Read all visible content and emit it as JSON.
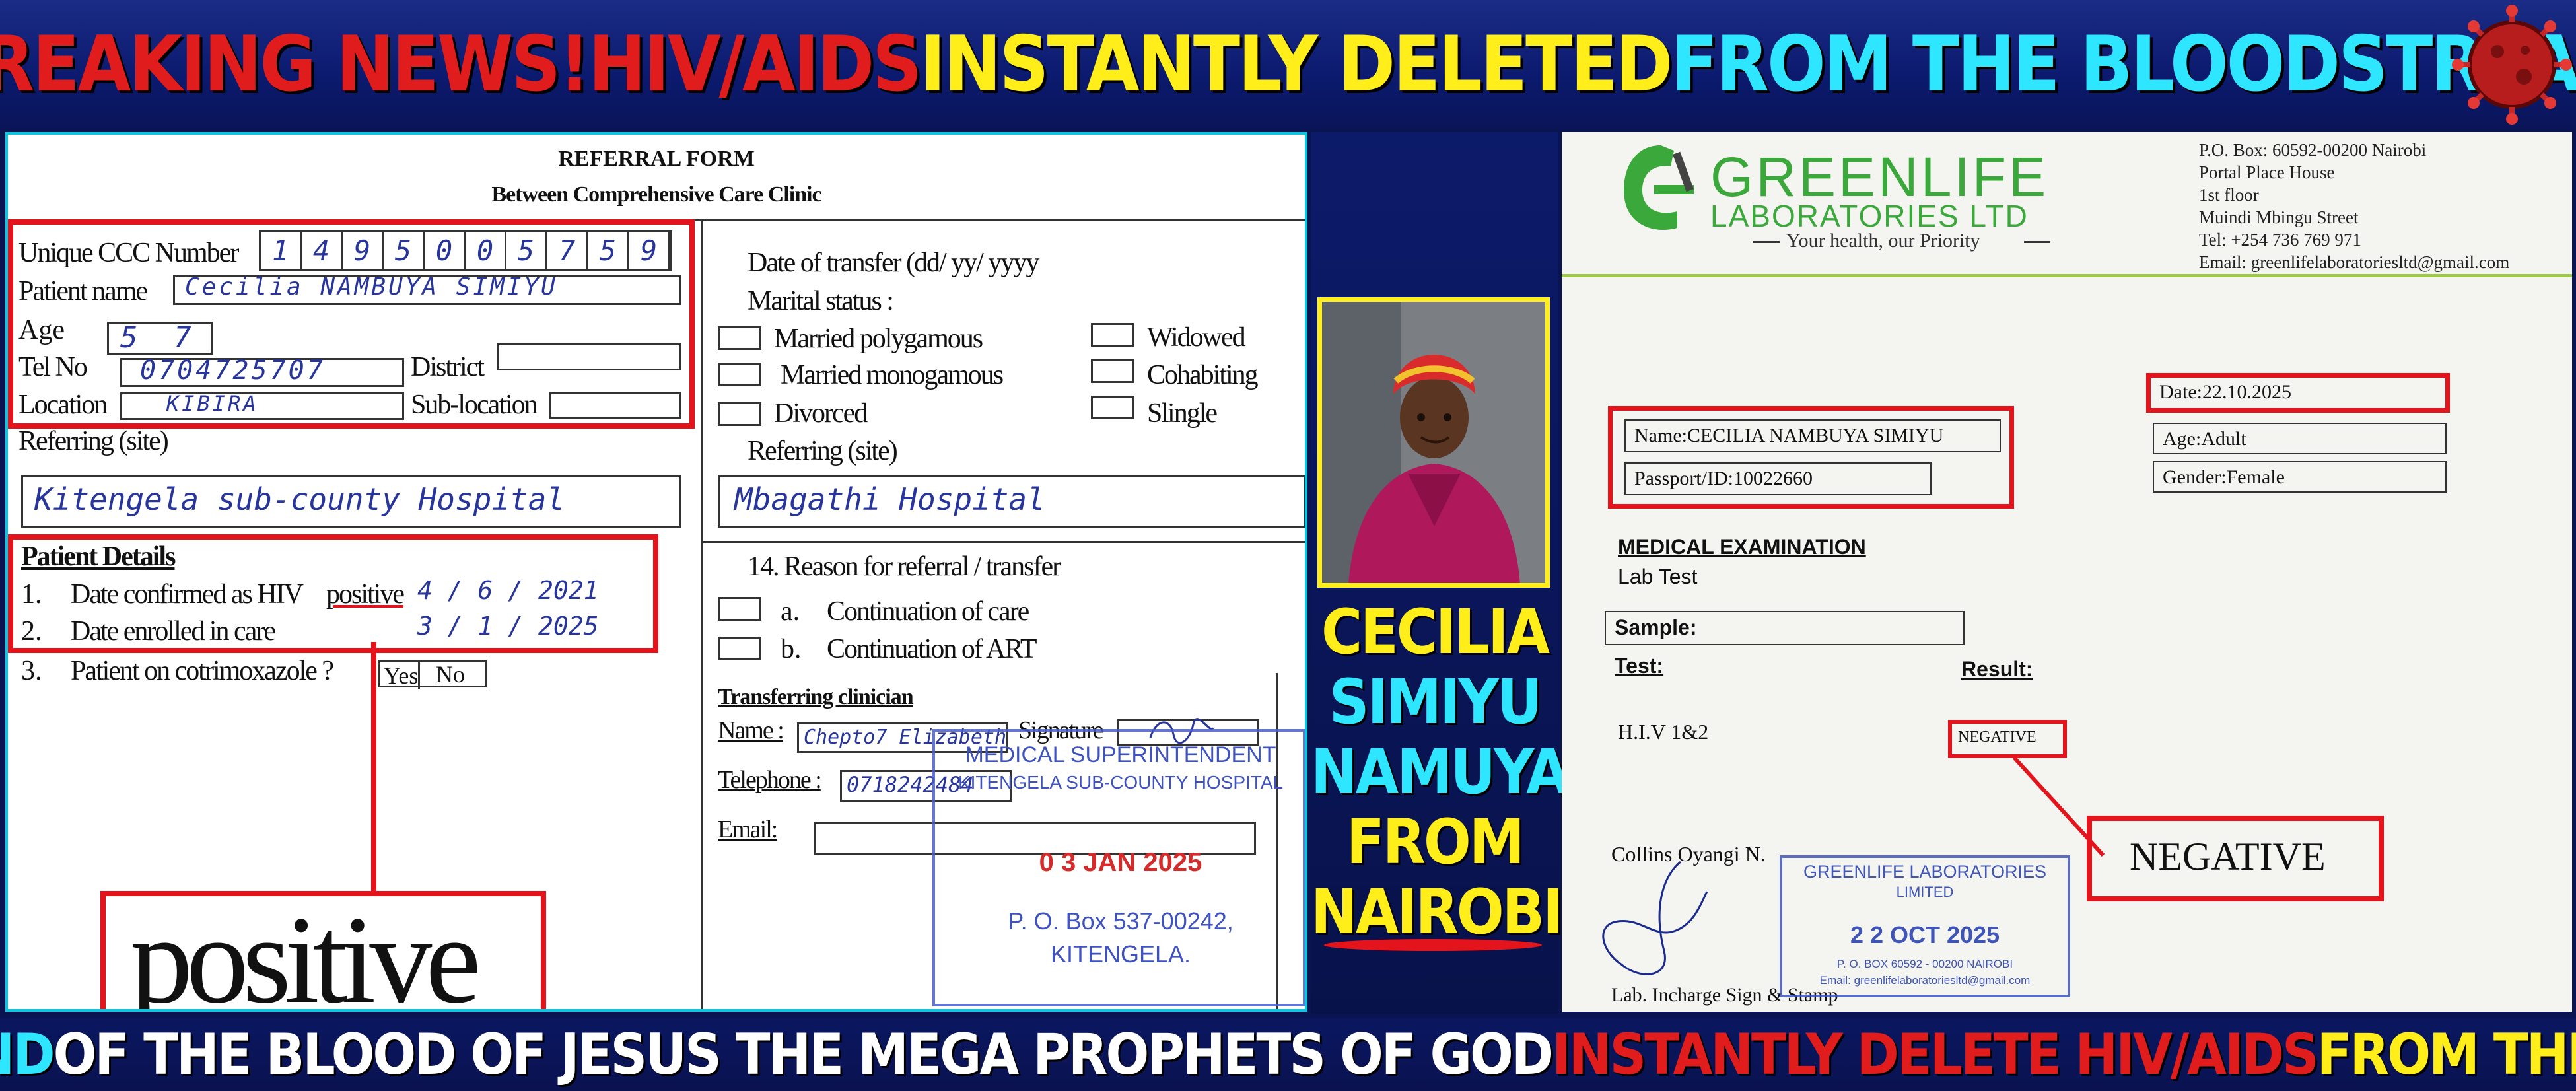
{
  "header": {
    "part1": "BREAKING NEWS!",
    "part2": "HIV/AIDS",
    "part3": "INSTANTLY DELETED",
    "part4": "FROM THE BLOODSTREAM"
  },
  "footer": {
    "part1": "AT ONE COMMAND",
    "part2": "OF THE BLOOD OF JESUS THE MEGA PROPHETS OF GOD",
    "part3": "INSTANTLY DELETE HIV/AIDS",
    "part4": "FROM THE BLOODSTREAM"
  },
  "referral": {
    "title": "REFERRAL FORM",
    "subtitle": "Between Comprehensive Care Clinic",
    "ccc_label": "Unique CCC Number",
    "ccc_digits": [
      "1",
      "4",
      "9",
      "5",
      "0",
      "0",
      "5",
      "7",
      "5",
      "9"
    ],
    "name_label": "Patient name",
    "name_value": "Cecilia NAMBUYA SIMIYU",
    "age_label": "Age",
    "age_value": "5 7",
    "tel_label": "Tel No",
    "tel_value": "0704725707",
    "district_label": "District",
    "location_label": "Location",
    "location_value": "KIBIRA",
    "sublocation_label": "Sub-location",
    "referring_label": "Referring (site)",
    "referring_value": "Kitengela sub-county Hospital",
    "date_transfer_label": "Date of transfer (dd/ yy/ yyyy",
    "marital_label": "Marital status :",
    "married_poly": "Married polygamous",
    "married_mono": "Married monogamous",
    "divorced": "Divorced",
    "widowed": "Widowed",
    "cohabiting": "Cohabiting",
    "single": "Slingle",
    "referring_to_label": "Referring (site)",
    "referring_to_value": "Mbagathi Hospital",
    "details_heading": "Patient Details",
    "d1_num": "1.",
    "d1_label": "Date confirmed as HIV",
    "d1_word": "positive",
    "d1_value": "4 / 6 / 2021",
    "d2_num": "2.",
    "d2_label": "Date enrolled in care",
    "d2_value": "3 / 1 / 2025",
    "d3_num": "3.",
    "d3_label": "Patient on cotrimoxazole ?",
    "d3_yes": "Yes",
    "d3_no": "No",
    "zoom_word": "positive",
    "reason_label": "14.   Reason for referral / transfer",
    "reason_a_letter": "a.",
    "reason_a": "Continuation of care",
    "reason_b_letter": "b.",
    "reason_b": "Continuation of ART",
    "clinician_heading": "Transferring clinician",
    "clin_name_label": "Name :",
    "clin_name_value": "Chepto7 Elizabeth",
    "signature_label": "Signature",
    "telephone_label": "Telephone :",
    "telephone_value": "0718242484",
    "email_label": "Email:",
    "stamp_line1": "MEDICAL SUPERINTENDENT",
    "stamp_line2": "KITENGELA SUB-COUNTY HOSPITAL",
    "stamp_date": "0 3 JAN 2025",
    "stamp_box": "P. O. Box 537-00242,",
    "stamp_town": "KITENGELA."
  },
  "person": {
    "name_lines": [
      "CECILIA",
      "SIMIYU",
      "NAMUYA",
      "FROM",
      "NAIROBI"
    ]
  },
  "lab": {
    "logo_line1": "GREENLIFE",
    "logo_line2": "LABORATORIES LTD",
    "tagline": "Your health, our Priority",
    "addr": [
      "P.O. Box: 60592-00200 Nairobi",
      "Portal Place House",
      "1st floor",
      "Muindi Mbingu Street",
      "Tel: +254 736 769 971",
      "Email: greenlifelaboratoriesltd@gmail.com"
    ],
    "date": "Date:22.10.2025",
    "age": "Age:Adult",
    "gender": "Gender:Female",
    "name": "Name:CECILIA  NAMBUYA  SIMIYU",
    "passport": "Passport/ID:10022660",
    "exam_heading": "MEDICAL EXAMINATION",
    "lab_test": "Lab Test",
    "sample": "Sample:",
    "test_label": "Test:",
    "result_label": "Result:",
    "test_name": "H.I.V 1&2",
    "result_small": "NEGATIVE",
    "result_big": "NEGATIVE",
    "tech": "Collins Oyangi N.",
    "incharge": "Lab. Incharge Sign & Stamp",
    "stamp_line1": "GREENLIFE LABORATORIES",
    "stamp_line2": "LIMITED",
    "stamp_date": "2 2 OCT 2025",
    "stamp_line3": "P. O. BOX 60592 - 00200 NAIROBI",
    "stamp_line4": "Email: greenlifelaboratoriesltd@gmail.com"
  },
  "colors": {
    "accent_red": "#e3141b",
    "banner_blue": "#0b1a6e",
    "headline_yellow": "#ffee1a",
    "headline_cyan": "#2ee6ff",
    "lab_green": "#3aa83a"
  }
}
